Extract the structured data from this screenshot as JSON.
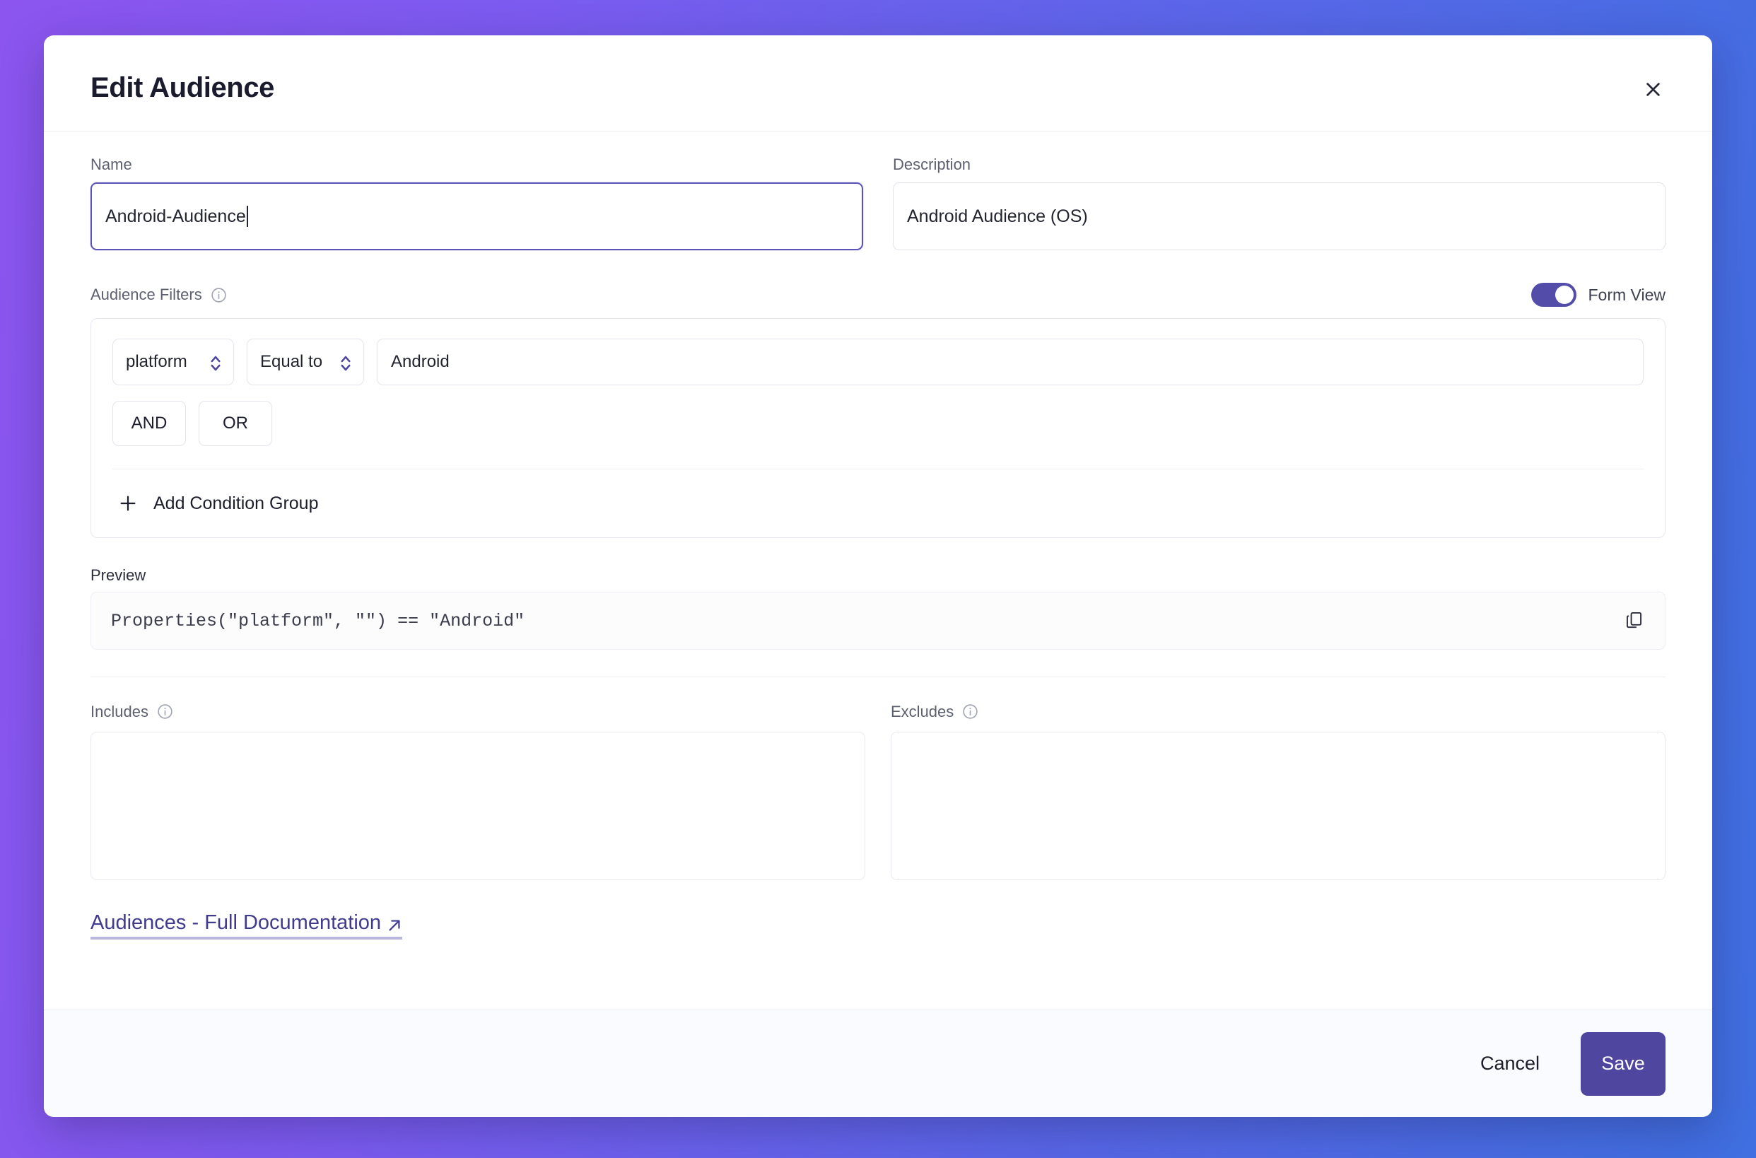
{
  "window": {
    "title": "Edit Audience",
    "close_icon": "close-icon"
  },
  "form": {
    "name": {
      "label": "Name",
      "value": "Android-Audience",
      "placeholder": "Name"
    },
    "description": {
      "label": "Description",
      "value": "Android Audience (OS)",
      "placeholder": "Description"
    }
  },
  "filters": {
    "label": "Audience Filters",
    "info_icon": "info-icon",
    "view_toggle": {
      "label": "Form View",
      "enabled": true
    },
    "condition": {
      "property": "platform",
      "operator": "Equal to",
      "value": "Android",
      "value_placeholder": "Value"
    },
    "logic": {
      "and_label": "AND",
      "or_label": "OR"
    },
    "add_group_label": "Add Condition Group",
    "add_group_icon": "plus-icon"
  },
  "preview": {
    "label": "Preview",
    "code": "Properties(\"platform\", \"\") == \"Android\"",
    "copy_icon": "copy-icon"
  },
  "includes": {
    "label": "Includes",
    "info_icon": "info-icon",
    "value": ""
  },
  "excludes": {
    "label": "Excludes",
    "info_icon": "info-icon",
    "value": ""
  },
  "documentation": {
    "label": "Audiences - Full Documentation",
    "external_icon": "external-link-icon"
  },
  "footer": {
    "cancel_label": "Cancel",
    "save_label": "Save"
  },
  "colors": {
    "accent": "#4f479f",
    "toggle_on": "#534ca8",
    "link": "#403b8f",
    "focus_border": "#5b53b8",
    "background_gradient_start": "#8C55EF",
    "background_gradient_end": "#3F6FE0"
  }
}
